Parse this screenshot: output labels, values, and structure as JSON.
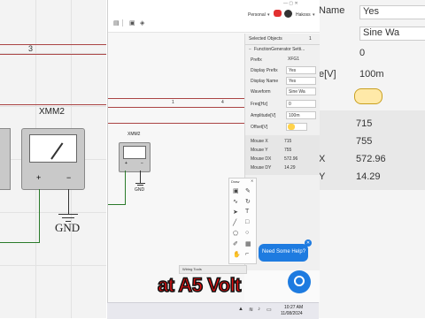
{
  "header": {
    "user_left": "Personal",
    "user_right": "Hakoss"
  },
  "panel": {
    "title": "Selected Objects",
    "count": "1",
    "object_name": "FunctionGenerator Setti...",
    "properties": [
      {
        "label": "Prefix",
        "value": "XFG1"
      },
      {
        "label": "Display Prefix",
        "value": "Yes"
      },
      {
        "label": "Display Name",
        "value": "Yes"
      },
      {
        "label": "Waveform",
        "value": "Sine Wa"
      },
      {
        "label": "Freq[Hz]",
        "value": "0"
      },
      {
        "label": "Amplitude[V]",
        "value": "100m"
      },
      {
        "label": "Offset[V]",
        "value": ""
      }
    ],
    "mouse": [
      {
        "label": "Mouse X",
        "value": "715"
      },
      {
        "label": "Mouse Y",
        "value": "755"
      },
      {
        "label": "Mouse DX",
        "value": "572.96"
      },
      {
        "label": "Mouse DY",
        "value": "14.29"
      }
    ]
  },
  "canvas": {
    "meter_label": "XMM2",
    "ground_label": "GND",
    "ruler_numbers": [
      "3",
      "1",
      "3",
      "4"
    ]
  },
  "left_zoom": {
    "meter_label": "XMM2",
    "ground_label": "GND",
    "number": "3"
  },
  "right_zoom": {
    "rows": [
      {
        "label": "Name",
        "value": "Yes"
      },
      {
        "label": "",
        "value": "Sine Wa"
      },
      {
        "label": "",
        "value": "0"
      },
      {
        "label": "e[V]",
        "value": "100m"
      },
      {
        "label": "",
        "value": "715"
      },
      {
        "label": "",
        "value": "755"
      },
      {
        "label": "X",
        "value": "572.96"
      },
      {
        "label": "Y",
        "value": "14.29"
      }
    ]
  },
  "draw_panel": {
    "title": "Draw",
    "footer": "Wiring Tools"
  },
  "help": {
    "label": "Need Some Help?"
  },
  "taskbar": {
    "time": "10:27 AM",
    "date": "11/08/2024"
  },
  "caption": {
    "text": "at A5 Volt"
  },
  "colors": {
    "accent_blue": "#1e7be0",
    "caption_red": "#e01010",
    "notification_red": "#e23030"
  }
}
